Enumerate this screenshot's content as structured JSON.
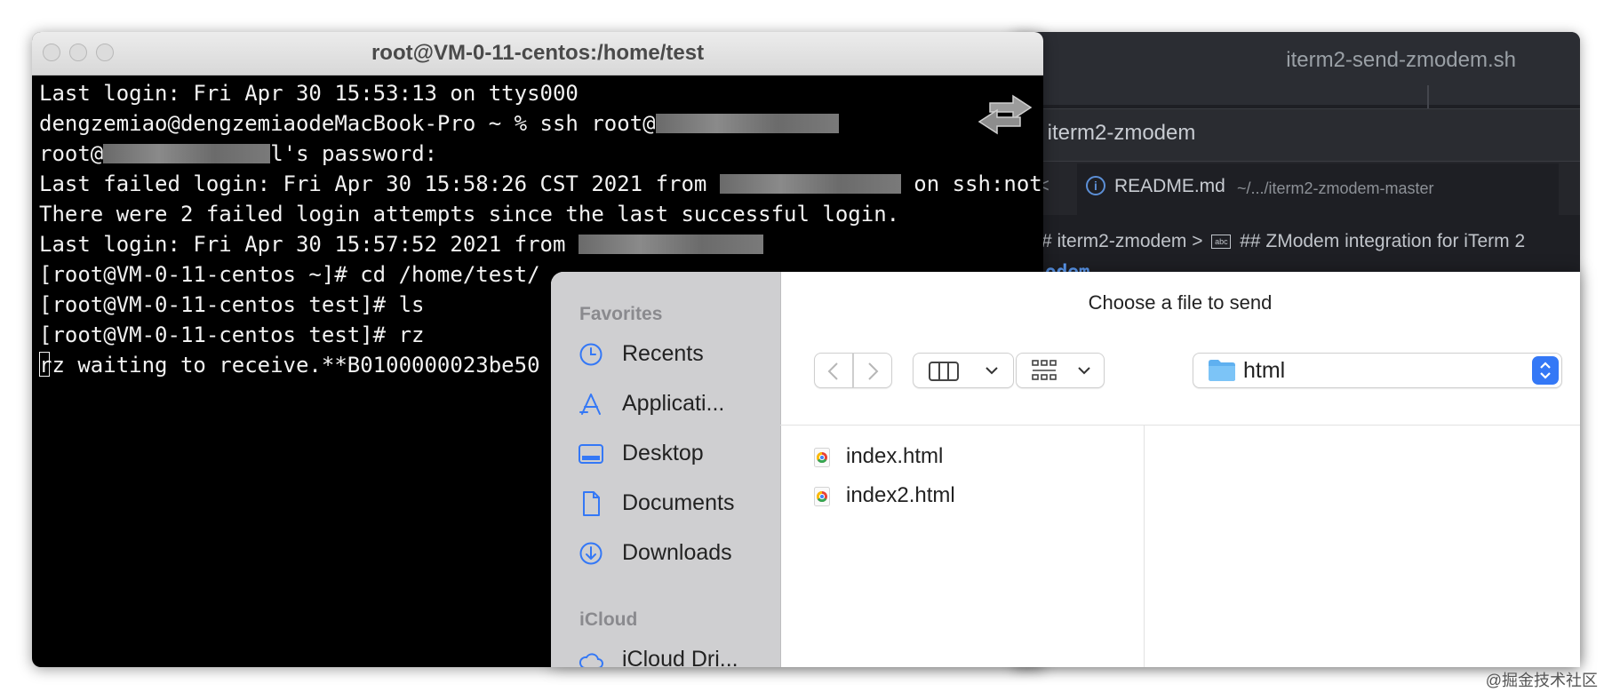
{
  "vscode": {
    "window_title": "iterm2-send-zmodem.sh",
    "explorer_title": "- iterm2-zmodem",
    "tab_chevron": "<",
    "tab_name": "README.md",
    "tab_path": "~/.../iterm2-zmodem-master",
    "breadcrumb_1": "# iterm2-zmodem",
    "breadcrumb_sep": ">",
    "breadcrumb_icon": "abc",
    "breadcrumb_2": "## ZModem integration for iTerm 2",
    "code_fragment": "odem"
  },
  "terminal": {
    "title": "root@VM-0-11-centos:/home/test",
    "lines": {
      "l1": "Last login: Fri Apr 30 15:53:13 on ttys000",
      "l2_prefix": "dengzemiao@dengzemiaodeMacBook-Pro ~ % ssh root@",
      "l3_prefix": "root@",
      "l3_suffix": "l's password:",
      "l4_prefix": "Last failed login: Fri Apr 30 15:58:26 CST 2021 from ",
      "l4_suffix": " on ssh:notty",
      "l5": "There were 2 failed login attempts since the last successful login.",
      "l6_prefix": "Last login: Fri Apr 30 15:57:52 2021 from ",
      "l7": "[root@VM-0-11-centos ~]# cd /home/test/",
      "l8": "[root@VM-0-11-centos test]# ls",
      "l9": "[root@VM-0-11-centos test]# rz",
      "l10": "rz waiting to receive.**B0100000023be50"
    }
  },
  "dialog": {
    "title": "Choose a file to send",
    "sidebar": {
      "favorites_header": "Favorites",
      "items": [
        {
          "label": "Recents",
          "icon": "clock-icon"
        },
        {
          "label": "Applicati...",
          "icon": "applications-icon"
        },
        {
          "label": "Desktop",
          "icon": "desktop-icon"
        },
        {
          "label": "Documents",
          "icon": "document-icon"
        },
        {
          "label": "Downloads",
          "icon": "download-icon"
        }
      ],
      "icloud_header": "iCloud",
      "icloud_items": [
        {
          "label": "iCloud Dri...",
          "icon": "cloud-icon"
        }
      ]
    },
    "location": "html",
    "files": [
      {
        "name": "index.html",
        "icon": "chrome-file-icon"
      },
      {
        "name": "index2.html",
        "icon": "chrome-file-icon"
      }
    ],
    "colors": {
      "accent": "#3478f6",
      "sidebar_icon": "#3478f6"
    }
  },
  "watermark": "@掘金技术社区"
}
